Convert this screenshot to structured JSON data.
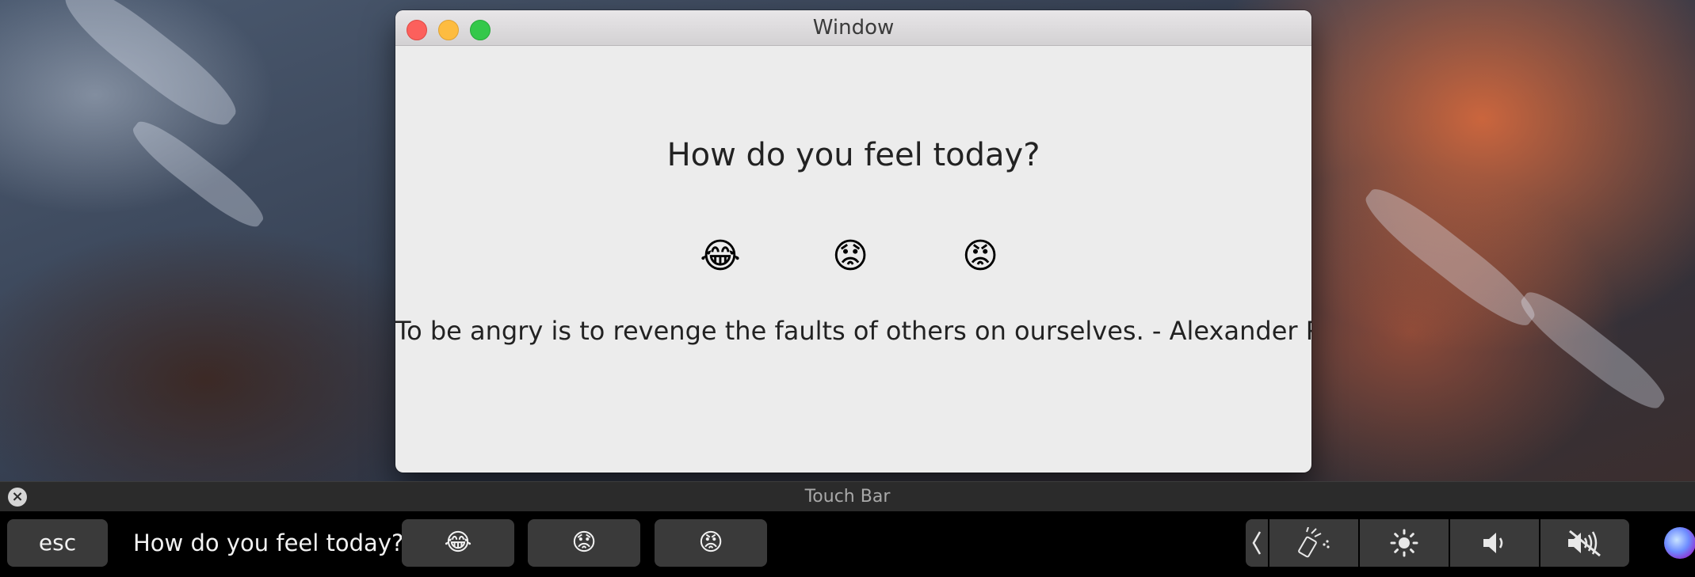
{
  "window": {
    "title": "Window",
    "question": "How do you feel today?",
    "emojis": [
      "😂",
      "😟",
      "😡"
    ],
    "quote": "To be angry is to revenge the faults of others on ourselves. - Alexander Pope"
  },
  "touchbar": {
    "header_title": "Touch Bar",
    "esc_label": "esc",
    "prompt": "How do you feel today?",
    "emojis": [
      "😂",
      "😟",
      "😡"
    ],
    "control_icons": [
      "collapse-chevron-icon",
      "screen-lock-icon",
      "brightness-icon",
      "volume-icon",
      "mute-icon",
      "siri-icon"
    ]
  },
  "colors": {
    "close": "#fc605c",
    "minimize": "#fdbc40",
    "zoom": "#34c84a",
    "touchbar_key": "#3a3a3a"
  }
}
